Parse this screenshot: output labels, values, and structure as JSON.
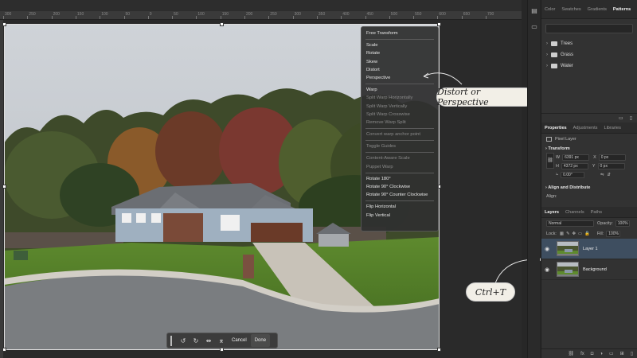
{
  "ruler": {
    "ticks": [
      "300",
      "250",
      "200",
      "150",
      "100",
      "50",
      "0",
      "50",
      "100",
      "150",
      "200",
      "250",
      "300",
      "350",
      "400",
      "450",
      "500",
      "550",
      "600",
      "650",
      "700"
    ]
  },
  "menu": {
    "groups": [
      [
        {
          "label": "Free Transform",
          "enabled": true
        }
      ],
      [
        {
          "label": "Scale",
          "enabled": true
        },
        {
          "label": "Rotate",
          "enabled": true
        },
        {
          "label": "Skew",
          "enabled": true
        },
        {
          "label": "Distort",
          "enabled": true
        },
        {
          "label": "Perspective",
          "enabled": true
        }
      ],
      [
        {
          "label": "Warp",
          "enabled": true
        },
        {
          "label": "Split Warp Horizontally",
          "enabled": false
        },
        {
          "label": "Split Warp Vertically",
          "enabled": false
        },
        {
          "label": "Split Warp Crosswise",
          "enabled": false
        },
        {
          "label": "Remove Warp Split",
          "enabled": false
        }
      ],
      [
        {
          "label": "Convert warp anchor point",
          "enabled": false
        }
      ],
      [
        {
          "label": "Toggle Guides",
          "enabled": false
        }
      ],
      [
        {
          "label": "Content-Aware Scale",
          "enabled": false
        },
        {
          "label": "Puppet Warp",
          "enabled": false
        }
      ],
      [
        {
          "label": "Rotate 180°",
          "enabled": true
        },
        {
          "label": "Rotate 90° Clockwise",
          "enabled": true
        },
        {
          "label": "Rotate 90° Counter Clockwise",
          "enabled": true
        }
      ],
      [
        {
          "label": "Flip Horizontal",
          "enabled": true
        },
        {
          "label": "Flip Vertical",
          "enabled": true
        }
      ]
    ]
  },
  "toolbar": {
    "cancel": "Cancel",
    "done": "Done"
  },
  "callouts": {
    "distort": "Distort or Perspective",
    "ctrl": "Ctrl+T"
  },
  "patterns_panel": {
    "tabs": [
      "Color",
      "Swatches",
      "Gradients",
      "Patterns"
    ],
    "active": "Patterns",
    "folders": [
      "Trees",
      "Grass",
      "Water"
    ]
  },
  "properties_panel": {
    "tabs": [
      "Properties",
      "Adjustments",
      "Libraries"
    ],
    "active": "Properties",
    "layer_type": "Pixel Layer",
    "transform_title": "Transform",
    "w_label": "W",
    "w_value": "6391 px",
    "h_label": "H",
    "h_value": "4372 px",
    "x_label": "X",
    "x_value": "0 px",
    "y_label": "Y",
    "y_value": "0 px",
    "angle_value": "0.00°",
    "align_title": "Align and Distribute",
    "align_label": "Align:"
  },
  "layers_panel": {
    "tabs": [
      "Layers",
      "Channels",
      "Paths"
    ],
    "active": "Layers",
    "blend_mode": "Normal",
    "opacity_label": "Opacity:",
    "opacity_value": "100%",
    "lock_label": "Lock:",
    "fill_label": "Fill:",
    "fill_value": "100%",
    "layers": [
      {
        "name": "Layer 1",
        "selected": true
      },
      {
        "name": "Background",
        "selected": false
      }
    ]
  }
}
